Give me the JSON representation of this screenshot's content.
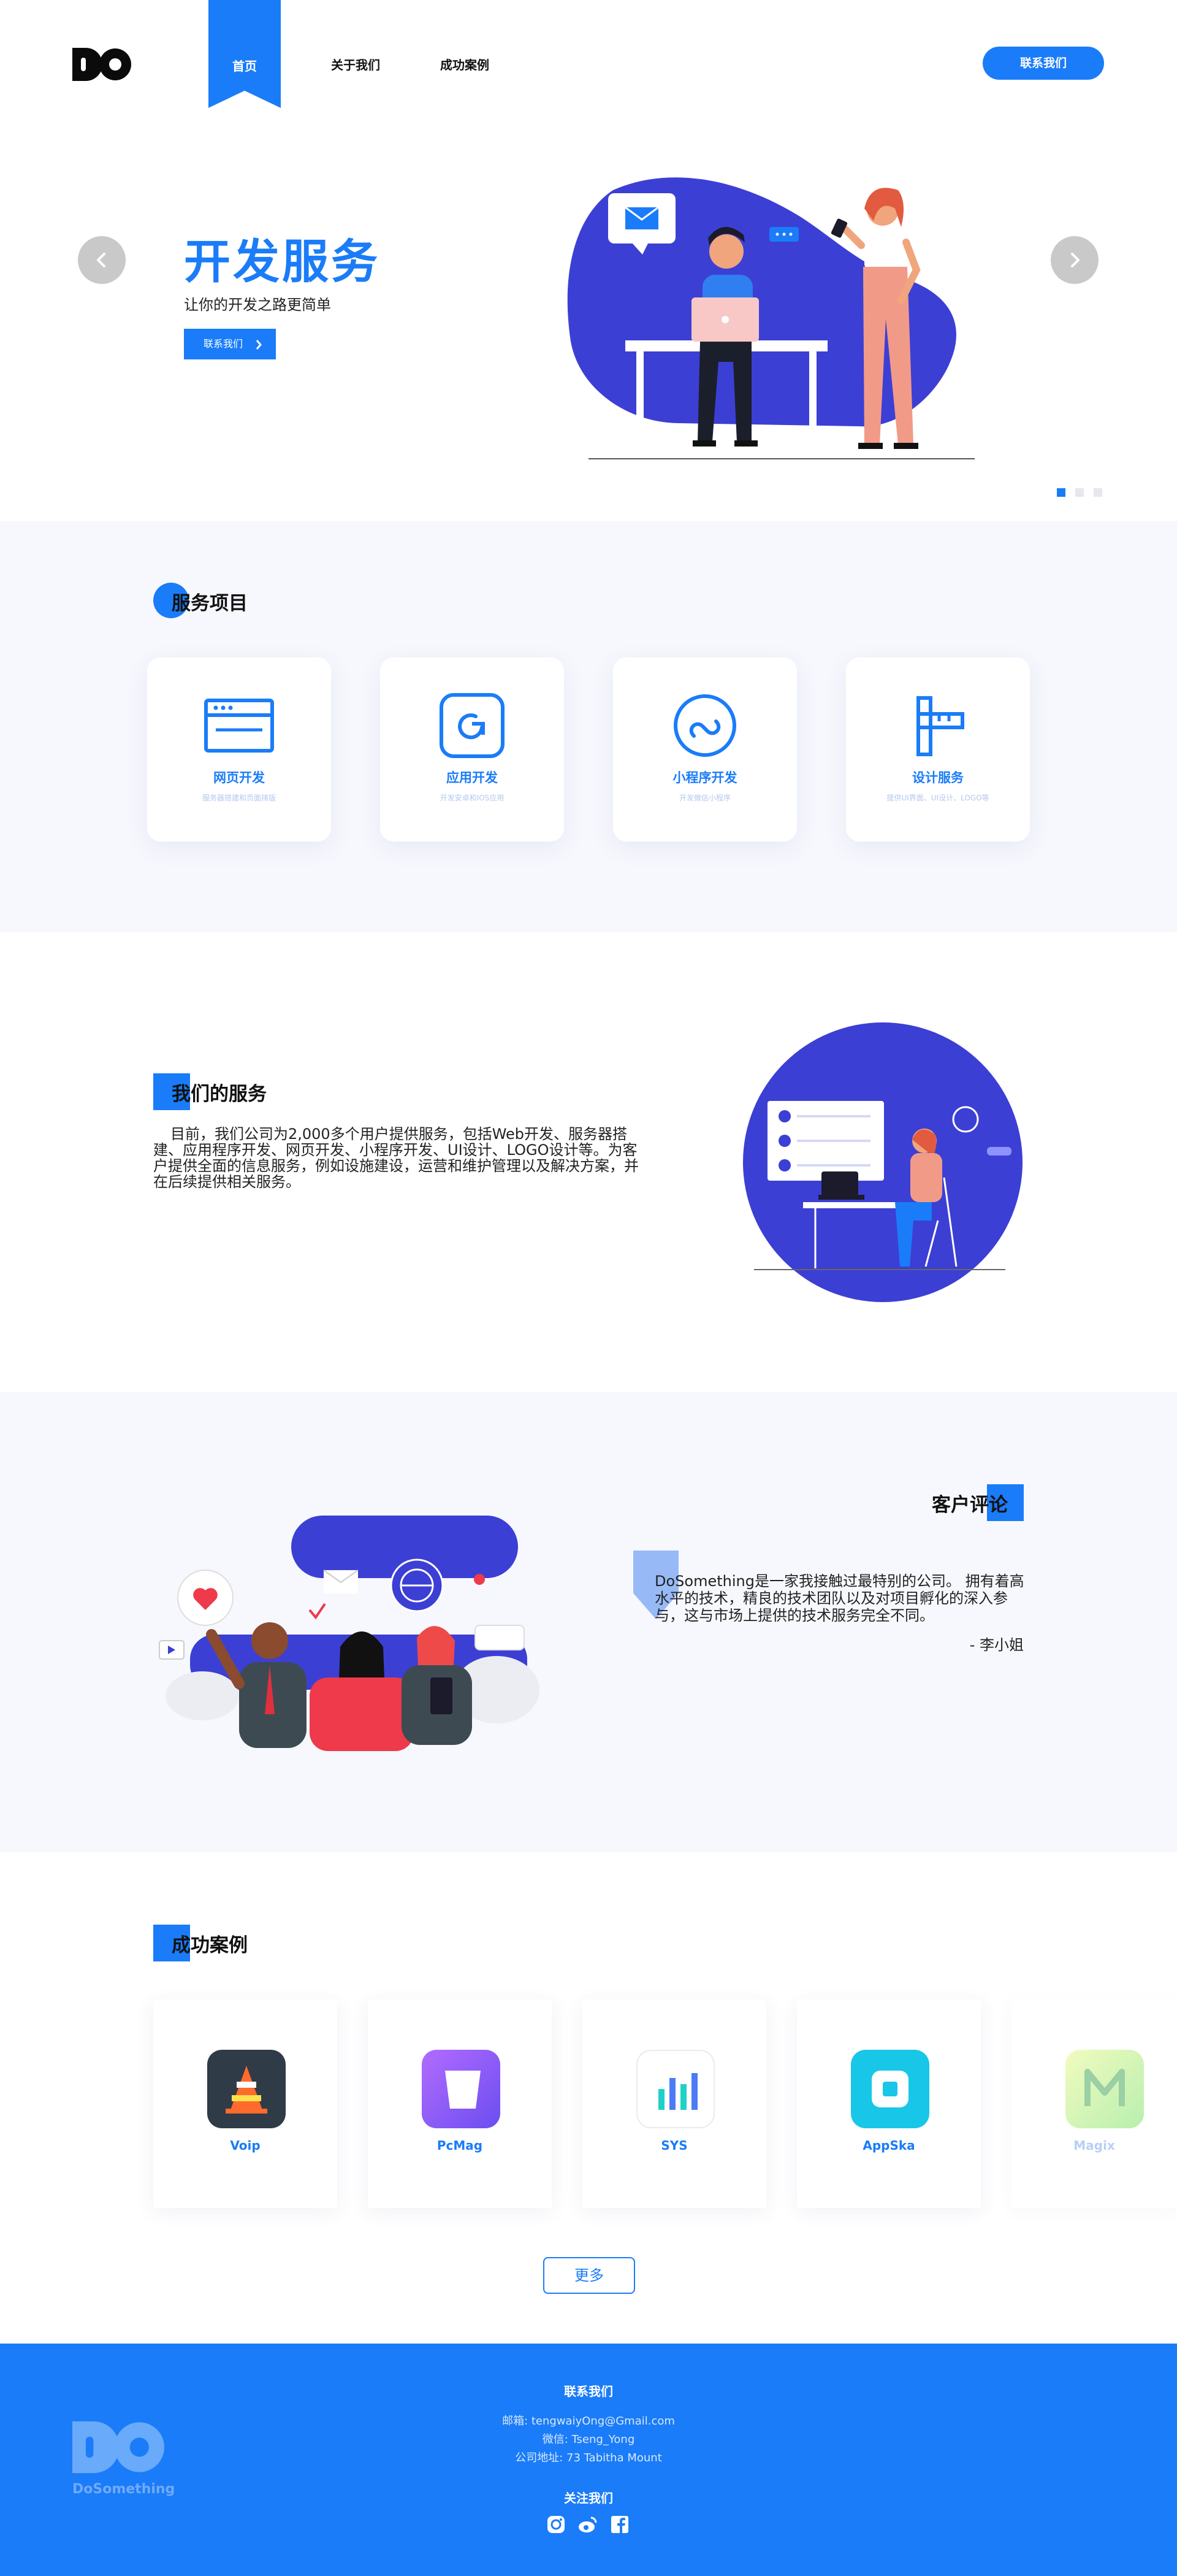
{
  "header": {
    "logo_text": "DO",
    "nav": [
      {
        "label": "首页",
        "active": true
      },
      {
        "label": "关于我们",
        "active": false
      },
      {
        "label": "成功案例",
        "active": false
      }
    ],
    "contact_button": "联系我们"
  },
  "hero": {
    "title": "开发服务",
    "subtitle": "让你的开发之路更简单",
    "button": "联系我们",
    "slides_total": 3,
    "slide_active": 1
  },
  "services": {
    "title": "服务项目",
    "items": [
      {
        "title": "网页开发",
        "desc": "服务器搭建和页面排版",
        "icon": "browser-window-icon"
      },
      {
        "title": "应用开发",
        "desc": "开发安卓和IOS应用",
        "icon": "app-icon"
      },
      {
        "title": "小程序开发",
        "desc": "开发微信小程序",
        "icon": "link-icon"
      },
      {
        "title": "设计服务",
        "desc": "提供UI界面、UI设计、LOGO等",
        "icon": "ruler-icon"
      }
    ]
  },
  "about": {
    "title": "我们的服务",
    "text": "目前，我们公司为2,000多个用户提供服务，包括Web开发、服务器搭建、应用程序开发、网页开发、小程序开发、UI设计、LOGO设计等。为客户提供全面的信息服务，例如设施建设，运营和维护管理以及解决方案，并在后续提供相关服务。"
  },
  "review": {
    "title": "客户评论",
    "text": "DoSomething是一家我接触过最特别的公司。 拥有着高水平的技术，精良的技术团队以及对项目孵化的深入参与，这与市场上提供的技术服务完全不同。",
    "author": "- 李小姐"
  },
  "cases": {
    "title": "成功案例",
    "items": [
      {
        "name": "Voip",
        "icon": "traffic-cone-icon",
        "color": "#2f3b47"
      },
      {
        "name": "PcMag",
        "icon": "parallelogram-icon",
        "color": "#8b5cf6"
      },
      {
        "name": "SYS",
        "icon": "bar-chart-icon",
        "color": "#ffffff"
      },
      {
        "name": "AppSka",
        "icon": "square-ring-icon",
        "color": "#18c6e8"
      },
      {
        "name": "Magix",
        "icon": "magix-m-icon",
        "color": "#a8e063"
      }
    ],
    "more_button": "更多"
  },
  "footer": {
    "contact_title": "联系我们",
    "email_line": "邮箱:  tengwaiyOng@Gmail.com",
    "wechat_line": "微信:  Tseng_Yong",
    "address_line": "公司地址:  73 Tabitha Mount",
    "follow_title": "关注我们",
    "brand": "DoSomething",
    "logo_text": "DO",
    "socials": [
      "instagram-icon",
      "weibo-icon",
      "facebook-icon"
    ]
  },
  "colors": {
    "accent": "#1a7cf8",
    "illustration_blue": "#3c3fd4",
    "band_bg": "#f7f8fe"
  }
}
